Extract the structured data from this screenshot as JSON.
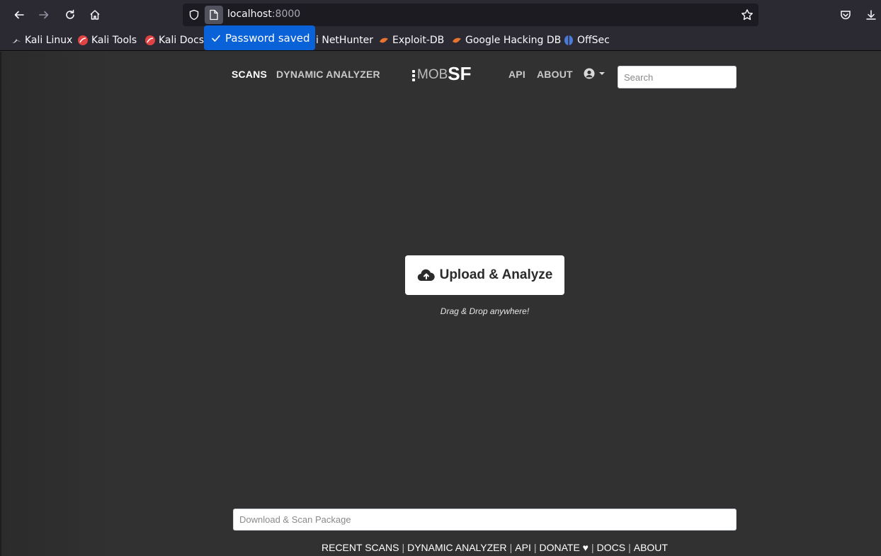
{
  "browser": {
    "url_host": "localhost",
    "url_port": ":8000",
    "password_toast": "Password saved",
    "bookmarks": [
      {
        "label": "Kali Linux",
        "icon": "kali-dragon-icon"
      },
      {
        "label": "Kali Tools",
        "icon": "kali-tools-icon"
      },
      {
        "label": "Kali Docs",
        "icon": "kali-docs-icon"
      },
      {
        "label": "i NetHunter",
        "icon": "nethunter-icon"
      },
      {
        "label": "Exploit-DB",
        "icon": "exploit-db-icon"
      },
      {
        "label": "Google Hacking DB",
        "icon": "ghdb-icon"
      },
      {
        "label": "OffSec",
        "icon": "offsec-icon"
      }
    ]
  },
  "nav": {
    "scans": "SCANS",
    "dynamic_analyzer": "DYNAMIC ANALYZER",
    "logo_mob": "MOB",
    "logo_sf": "SF",
    "api": "API",
    "about": "ABOUT",
    "search_placeholder": "Search"
  },
  "main": {
    "upload_label": "Upload & Analyze",
    "drag_hint": "Drag & Drop anywhere!",
    "package_placeholder": "Download & Scan Package"
  },
  "footer": {
    "links": [
      "RECENT SCANS",
      "DYNAMIC ANALYZER",
      "API",
      "DONATE ♥",
      "DOCS",
      "ABOUT"
    ],
    "separator": "|"
  },
  "colors": {
    "page_bg": "#313131",
    "chrome_bg": "#2b2a33",
    "toast_blue": "#0a62d8"
  }
}
